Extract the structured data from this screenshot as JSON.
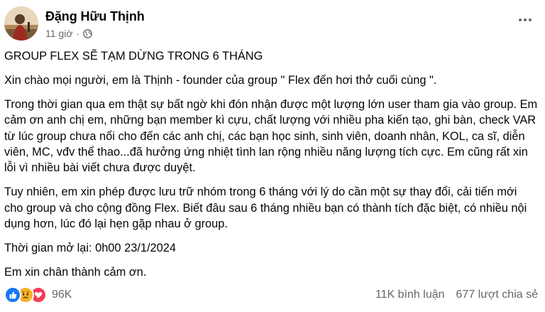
{
  "post": {
    "author": "Đặng Hữu Thịnh",
    "time": "11 giờ",
    "separator": "·",
    "privacy_icon": "globe-icon",
    "more_icon": "more-options-icon",
    "paragraphs": [
      "GROUP FLEX SẼ TẠM DỪNG TRONG 6 THÁNG",
      "Xin chào mọi người, em là Thịnh - founder của group \" Flex đến hơi thở cuối cùng \".",
      "Trong thời gian qua em thật sự bất ngờ khi đón nhận được một lượng lớn user tham gia vào group. Em cảm ơn anh chị em, những bạn member kì cựu, chất lượng với nhiều pha kiến tạo, ghi bàn, check VAR từ lúc group chưa nổi cho đến các anh chị, các bạn học sinh, sinh viên, doanh nhân, KOL, ca sĩ, diễn viên, MC, vđv thể thao...đã hưởng ứng nhiệt tình lan rộng nhiều năng lượng tích cực. Em cũng rất xin lỗi vì nhiều bài viết chưa được duyệt.",
      "Tuy nhiên, em xin phép được lưu trữ nhóm trong 6 tháng với lý do cần một sự thay đổi, cải tiến mới cho group và cho cộng đồng Flex. Biết đâu sau 6 tháng nhiều bạn có thành tích đặc biệt, có nhiều nội dụng hơn, lúc đó lại hẹn gặp nhau ở group.",
      "Thời gian mở lại: 0h00 23/1/2024",
      "Em xin chân thành cảm ơn."
    ]
  },
  "footer": {
    "reaction_icons": [
      "like-icon",
      "sad-icon",
      "love-icon"
    ],
    "reaction_count": "96K",
    "comments": "11K bình luận",
    "shares": "677 lượt chia sẻ"
  },
  "colors": {
    "text": "#050505",
    "secondary": "#65676b",
    "like": "#1877f2",
    "sad": "#f7b125",
    "love": "#f33e58"
  }
}
